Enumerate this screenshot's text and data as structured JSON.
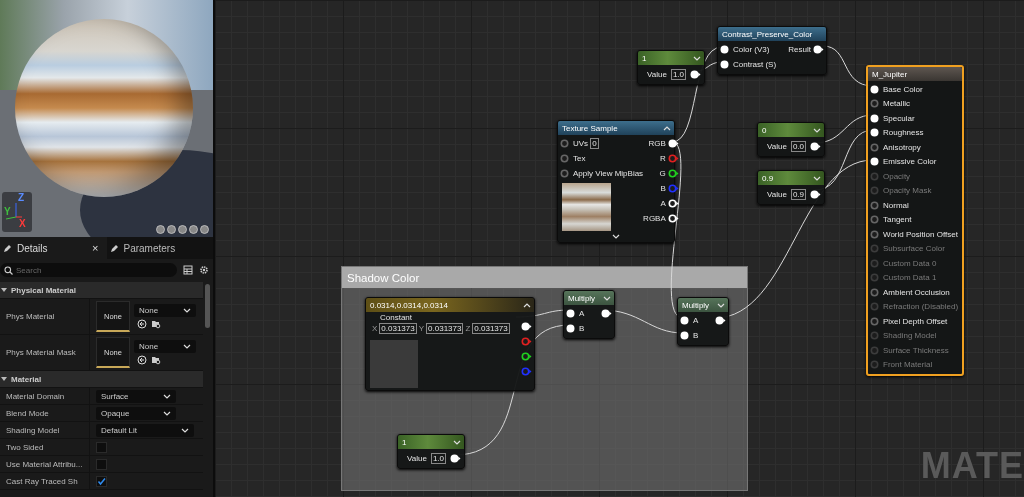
{
  "viewport": {
    "axis_labels": [
      {
        "axis": "Z",
        "color": "#5a8cff"
      },
      {
        "axis": "Y",
        "color": "#3fbf3f"
      },
      {
        "axis": "X",
        "color": "#ff3a3a"
      }
    ]
  },
  "details": {
    "tabs": [
      {
        "label": "Details",
        "selected": true,
        "close": "×"
      },
      {
        "label": "Parameters",
        "selected": false
      }
    ],
    "search": {
      "placeholder": "Search"
    },
    "sections": [
      {
        "title": "Physical Material",
        "expanded": true,
        "rows": [
          {
            "kind": "asset",
            "label": "Phys Material",
            "thumb": "None",
            "value": "None"
          },
          {
            "kind": "asset",
            "label": "Phys Material Mask",
            "thumb": "None",
            "value": "None"
          }
        ]
      },
      {
        "title": "Material",
        "expanded": true,
        "rows": [
          {
            "kind": "dropdown",
            "label": "Material Domain",
            "value": "Surface"
          },
          {
            "kind": "dropdown",
            "label": "Blend Mode",
            "value": "Opaque"
          },
          {
            "kind": "dropdown",
            "label": "Shading Model",
            "value": "Default Lit"
          },
          {
            "kind": "checkbox",
            "label": "Two Sided",
            "checked": false
          },
          {
            "kind": "checkbox",
            "label": "Use Material Attribu...",
            "checked": false
          },
          {
            "kind": "checkbox",
            "label": "Cast Ray Traced Sh",
            "checked": true
          }
        ]
      }
    ]
  },
  "graph": {
    "comment": {
      "title": "Shadow Color"
    },
    "nodes": [
      {
        "kind": "function",
        "title": "Contrast_Preserve_Color",
        "inputs": [
          {
            "label": "Color (V3)",
            "connected": true
          },
          {
            "label": "Contrast (S)",
            "connected": true
          }
        ],
        "outputs": [
          {
            "label": "Result",
            "connected": true
          }
        ]
      },
      {
        "kind": "scalar",
        "title": "1",
        "value_label": "Value",
        "value": "1.0",
        "outputs": [
          {
            "connected": true
          }
        ]
      },
      {
        "kind": "result",
        "title": "M_Jupiter",
        "selected": true,
        "inputs": [
          {
            "label": "Base Color",
            "connected": true,
            "disabled": false
          },
          {
            "label": "Metallic",
            "connected": false,
            "disabled": false
          },
          {
            "label": "Specular",
            "connected": true,
            "disabled": false
          },
          {
            "label": "Roughness",
            "connected": true,
            "disabled": false
          },
          {
            "label": "Anisotropy",
            "connected": false,
            "disabled": false
          },
          {
            "label": "Emissive Color",
            "connected": true,
            "disabled": false
          },
          {
            "label": "Opacity",
            "connected": false,
            "disabled": true
          },
          {
            "label": "Opacity Mask",
            "connected": false,
            "disabled": true
          },
          {
            "label": "Normal",
            "connected": false,
            "disabled": false
          },
          {
            "label": "Tangent",
            "connected": false,
            "disabled": false
          },
          {
            "label": "World Position Offset",
            "connected": false,
            "disabled": false
          },
          {
            "label": "Subsurface Color",
            "connected": false,
            "disabled": true
          },
          {
            "label": "Custom Data 0",
            "connected": false,
            "disabled": true
          },
          {
            "label": "Custom Data 1",
            "connected": false,
            "disabled": true
          },
          {
            "label": "Ambient Occlusion",
            "connected": false,
            "disabled": false
          },
          {
            "label": "Refraction (Disabled)",
            "connected": false,
            "disabled": true
          },
          {
            "label": "Pixel Depth Offset",
            "connected": false,
            "disabled": false
          },
          {
            "label": "Shading Model",
            "connected": false,
            "disabled": true
          },
          {
            "label": "Surface Thickness",
            "connected": false,
            "disabled": true
          },
          {
            "label": "Front Material",
            "connected": false,
            "disabled": true
          }
        ]
      },
      {
        "kind": "texture",
        "title": "Texture Sample",
        "inputs": [
          {
            "label": "UVs",
            "value": "0",
            "connected": false
          },
          {
            "label": "Tex",
            "connected": false
          },
          {
            "label": "Apply View MipBias",
            "connected": false
          }
        ],
        "outputs": [
          {
            "label": "RGB",
            "connected": true,
            "color": "#ffffff"
          },
          {
            "label": "R",
            "connected": false,
            "color": "#e02020"
          },
          {
            "label": "G",
            "connected": false,
            "color": "#20d020"
          },
          {
            "label": "B",
            "connected": false,
            "color": "#2030ff"
          },
          {
            "label": "A",
            "connected": false,
            "color": "#ffffff"
          },
          {
            "label": "RGBA",
            "connected": false,
            "color": "#ffffff"
          }
        ]
      },
      {
        "kind": "scalar",
        "title": "0",
        "value_label": "Value",
        "value": "0.0",
        "outputs": [
          {
            "connected": true
          }
        ]
      },
      {
        "kind": "scalar",
        "title": "0.9",
        "value_label": "Value",
        "value": "0.9",
        "outputs": [
          {
            "connected": true
          }
        ]
      },
      {
        "kind": "vector",
        "title": "0.0314,0.0314,0.0314",
        "label": "Constant",
        "components": [
          {
            "axis": "X",
            "value": "0.031373"
          },
          {
            "axis": "Y",
            "value": "0.031373"
          },
          {
            "axis": "Z",
            "value": "0.031373"
          }
        ],
        "outputs": [
          {
            "connected": true,
            "color": "#ffffff"
          },
          {
            "connected": false,
            "color": "#e02020"
          },
          {
            "connected": false,
            "color": "#20d020"
          },
          {
            "connected": false,
            "color": "#2030ff"
          }
        ]
      },
      {
        "kind": "multiply",
        "title": "Multiply",
        "inputs": [
          {
            "label": "A",
            "connected": true
          },
          {
            "label": "B",
            "connected": true
          }
        ],
        "outputs": [
          {
            "connected": true
          }
        ]
      },
      {
        "kind": "multiply",
        "title": "Multiply",
        "inputs": [
          {
            "label": "A",
            "connected": true
          },
          {
            "label": "B",
            "connected": true
          }
        ],
        "outputs": [
          {
            "connected": true
          }
        ]
      },
      {
        "kind": "scalar",
        "title": "1",
        "value_label": "Value",
        "value": "1.0",
        "outputs": [
          {
            "connected": true
          }
        ]
      }
    ],
    "corner_label": "MATE"
  }
}
